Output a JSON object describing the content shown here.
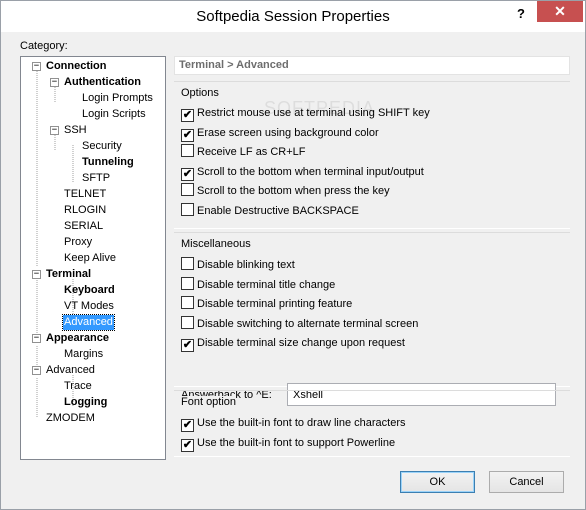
{
  "window": {
    "title": "Softpedia Session Properties",
    "help_glyph": "?",
    "close_glyph": "✕"
  },
  "category_label": "Category:",
  "tree": [
    {
      "label": "Connection",
      "bold": true
    },
    {
      "label": "Authentication",
      "bold": true
    },
    {
      "label": "Login Prompts",
      "bold": false
    },
    {
      "label": "Login Scripts",
      "bold": false
    },
    {
      "label": "SSH",
      "bold": false
    },
    {
      "label": "Security",
      "bold": false
    },
    {
      "label": "Tunneling",
      "bold": true
    },
    {
      "label": "SFTP",
      "bold": false
    },
    {
      "label": "TELNET",
      "bold": false
    },
    {
      "label": "RLOGIN",
      "bold": false
    },
    {
      "label": "SERIAL",
      "bold": false
    },
    {
      "label": "Proxy",
      "bold": false
    },
    {
      "label": "Keep Alive",
      "bold": false
    },
    {
      "label": "Terminal",
      "bold": true
    },
    {
      "label": "Keyboard",
      "bold": true
    },
    {
      "label": "VT Modes",
      "bold": false
    },
    {
      "label": "Advanced",
      "bold": false,
      "selected": true
    },
    {
      "label": "Appearance",
      "bold": true
    },
    {
      "label": "Margins",
      "bold": false
    },
    {
      "label": "Advanced",
      "bold": false
    },
    {
      "label": "Trace",
      "bold": false
    },
    {
      "label": "Logging",
      "bold": true
    },
    {
      "label": "ZMODEM",
      "bold": false
    }
  ],
  "panel": {
    "breadcrumb": "Terminal > Advanced",
    "watermark": "SOFTPEDIA",
    "options": {
      "title": "Options",
      "items": [
        {
          "label": "Restrict mouse use at terminal using SHIFT key",
          "checked": true
        },
        {
          "label": "Erase screen using background color",
          "checked": true
        },
        {
          "label": "Receive LF as CR+LF",
          "checked": false
        },
        {
          "label": "Scroll to the bottom when terminal input/output",
          "checked": true
        },
        {
          "label": "Scroll to the bottom when press the key",
          "checked": false
        },
        {
          "label": "Enable Destructive BACKSPACE",
          "checked": false
        }
      ]
    },
    "misc": {
      "title": "Miscellaneous",
      "items": [
        {
          "label": "Disable blinking text",
          "checked": false
        },
        {
          "label": "Disable terminal title change",
          "checked": false
        },
        {
          "label": "Disable terminal printing feature",
          "checked": false
        },
        {
          "label": "Disable switching to alternate terminal screen",
          "checked": false
        },
        {
          "label": "Disable terminal size change upon request",
          "checked": true
        }
      ],
      "answerback_label": "Answerback to ^E:",
      "answerback_value": "Xshell"
    },
    "font": {
      "title": "Font option",
      "items": [
        {
          "label": "Use the built-in font to draw line characters",
          "checked": true
        },
        {
          "label": "Use the built-in font to support Powerline",
          "checked": true
        }
      ]
    }
  },
  "buttons": {
    "ok": "OK",
    "cancel": "Cancel"
  },
  "check_glyph": "✔"
}
